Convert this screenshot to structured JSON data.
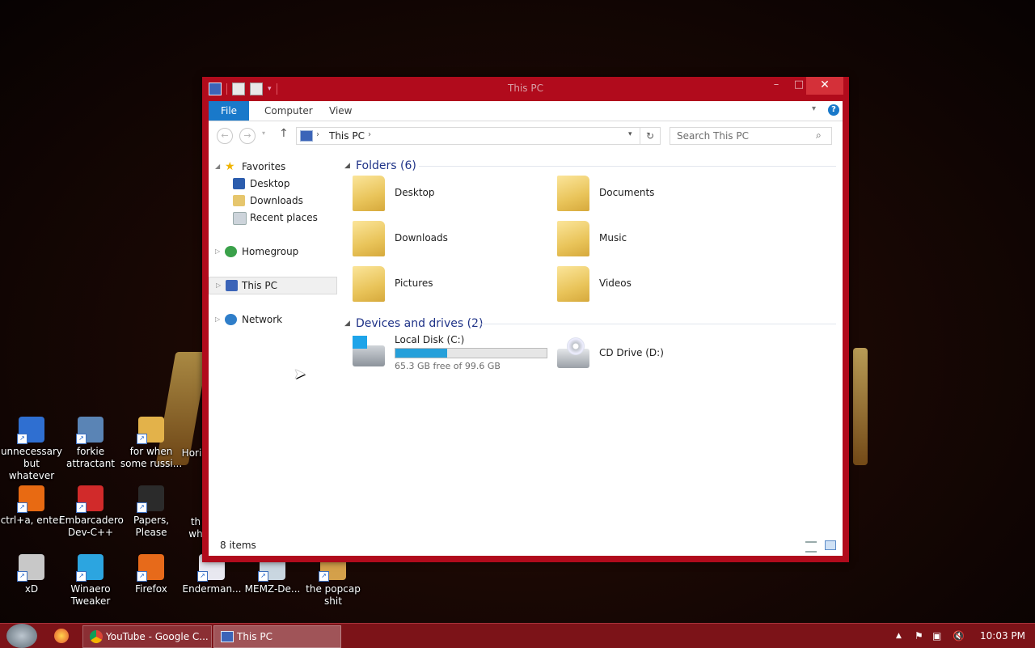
{
  "desktop": {
    "icons": [
      {
        "label": "unnecessary but whatever",
        "line1": "unnecessary",
        "line2": "but whatever",
        "icon": "help-shortcut-icon",
        "color": "#2f6fd1"
      },
      {
        "label": "forkie attractant",
        "line1": "forkie",
        "line2": "attractant",
        "icon": "settings-program-icon",
        "color": "#5a84b5"
      },
      {
        "label": "for when some russi...",
        "line1": "for when",
        "line2": "some russi...",
        "icon": "app-icon",
        "color": "#e3b24a"
      },
      {
        "label": "ctrl+a, enter",
        "line1": "ctrl+a, enter",
        "line2": "",
        "icon": "orange-ring-icon",
        "color": "#e86a12"
      },
      {
        "label": "Embarcadero Dev-C++",
        "line1": "Embarcadero",
        "line2": "Dev-C++",
        "icon": "devcpp-icon",
        "color": "#d12a2a"
      },
      {
        "label": "Papers, Please",
        "line1": "Papers,",
        "line2": "Please",
        "icon": "papers-please-icon",
        "color": "#2b2b2b"
      },
      {
        "label": "xD",
        "line1": "xD",
        "line2": "",
        "icon": "xd-icon",
        "color": "#c8c8c8"
      },
      {
        "label": "Winaero Tweaker",
        "line1": "Winaero",
        "line2": "Tweaker",
        "icon": "winaero-icon",
        "color": "#2ca5e0"
      },
      {
        "label": "Firefox",
        "line1": "Firefox",
        "line2": "",
        "icon": "firefox-icon",
        "color": "#e76a1a"
      },
      {
        "label": "Enderman...",
        "line1": "Enderman...",
        "line2": "",
        "icon": "document-icon",
        "color": "#e8e8f0"
      },
      {
        "label": "MEMZ-De...",
        "line1": "MEMZ-De...",
        "line2": "",
        "icon": "recycle-bin-icon",
        "color": "#c9d6e0"
      },
      {
        "label": "the popcap shit",
        "line1": "the popcap",
        "line2": "shit",
        "icon": "popcap-icon",
        "color": "#d4a04a"
      }
    ],
    "partial_left": "Hori",
    "partial_mid": "th",
    "partial_mid2": "wh"
  },
  "window": {
    "title": "This PC",
    "min": "–",
    "max": "□",
    "close": "✕",
    "ribbon": {
      "file": "File",
      "tabs": [
        "Computer",
        "View"
      ]
    },
    "address": {
      "path": "This PC",
      "sep": "›"
    },
    "search_placeholder": "Search This PC",
    "nav": {
      "favorites": "Favorites",
      "favorites_items": [
        "Desktop",
        "Downloads",
        "Recent places"
      ],
      "homegroup": "Homegroup",
      "this_pc": "This PC",
      "network": "Network"
    },
    "groups": {
      "folders_title": "Folders (6)",
      "drives_title": "Devices and drives (2)"
    },
    "folders": [
      "Desktop",
      "Documents",
      "Downloads",
      "Music",
      "Pictures",
      "Videos"
    ],
    "drives": {
      "c_name": "Local Disk (C:)",
      "c_free": "65.3 GB free of 99.6 GB",
      "c_used_fraction": 0.344,
      "d_name": "CD Drive (D:)"
    },
    "status": "8 items"
  },
  "taskbar": {
    "start": "start",
    "chrome": "YouTube - Google C...",
    "explorer": "This PC",
    "time": "10:03 PM"
  },
  "colors": {
    "accent": "#1979ca",
    "window_frame": "#b10b1c",
    "taskbar": "#7c1318",
    "drive_bar": "#26a0da"
  }
}
